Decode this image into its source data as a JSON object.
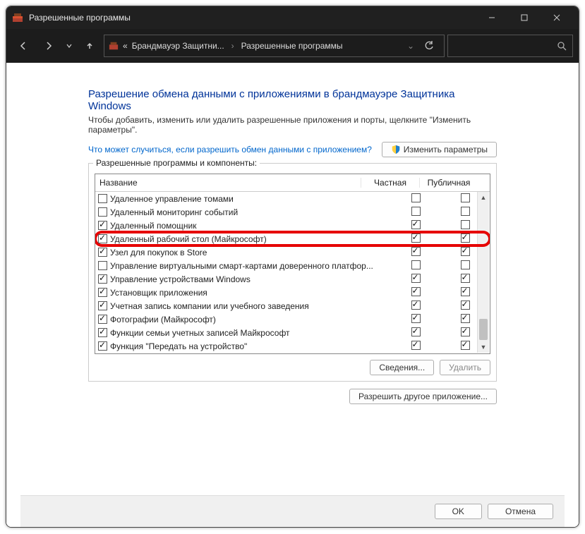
{
  "window": {
    "title": "Разрешенные программы"
  },
  "breadcrumbs": {
    "prefix": "«",
    "level1": "Брандмауэр Защитни...",
    "level2": "Разрешенные программы"
  },
  "page": {
    "heading": "Разрешение обмена данными с приложениями в брандмауэре Защитника Windows",
    "instruction": "Чтобы добавить, изменить или удалить разрешенные приложения и порты, щелкните \"Изменить параметры\".",
    "help_link": "Что может случиться, если разрешить обмен данными с приложением?",
    "change_settings": "Изменить параметры",
    "group_label": "Разрешенные программы и компоненты:",
    "details": "Сведения...",
    "delete": "Удалить",
    "allow_other": "Разрешить другое приложение...",
    "ok": "OK",
    "cancel": "Отмена"
  },
  "columns": {
    "name": "Название",
    "private": "Частная",
    "public": "Публичная"
  },
  "rows": [
    {
      "enabled": false,
      "label": "Удаленное управление томами",
      "priv": false,
      "pub": false
    },
    {
      "enabled": false,
      "label": "Удаленный мониторинг событий",
      "priv": false,
      "pub": false
    },
    {
      "enabled": true,
      "label": "Удаленный помощник",
      "priv": true,
      "pub": false
    },
    {
      "enabled": true,
      "label": "Удаленный рабочий стол (Майкрософт)",
      "priv": true,
      "pub": true,
      "highlight": true
    },
    {
      "enabled": true,
      "label": "Узел для покупок в Store",
      "priv": true,
      "pub": true
    },
    {
      "enabled": false,
      "label": "Управление виртуальными смарт-картами доверенного платфор...",
      "priv": false,
      "pub": false
    },
    {
      "enabled": true,
      "label": "Управление устройствами Windows",
      "priv": true,
      "pub": true
    },
    {
      "enabled": true,
      "label": "Установщик приложения",
      "priv": true,
      "pub": true
    },
    {
      "enabled": true,
      "label": "Учетная запись компании или учебного заведения",
      "priv": true,
      "pub": true
    },
    {
      "enabled": true,
      "label": "Фотографии (Майкрософт)",
      "priv": true,
      "pub": true
    },
    {
      "enabled": true,
      "label": "Функции семьи учетных записей Майкрософт",
      "priv": true,
      "pub": true
    },
    {
      "enabled": true,
      "label": "Функция \"Передать на устройство\"",
      "priv": true,
      "pub": true
    }
  ]
}
